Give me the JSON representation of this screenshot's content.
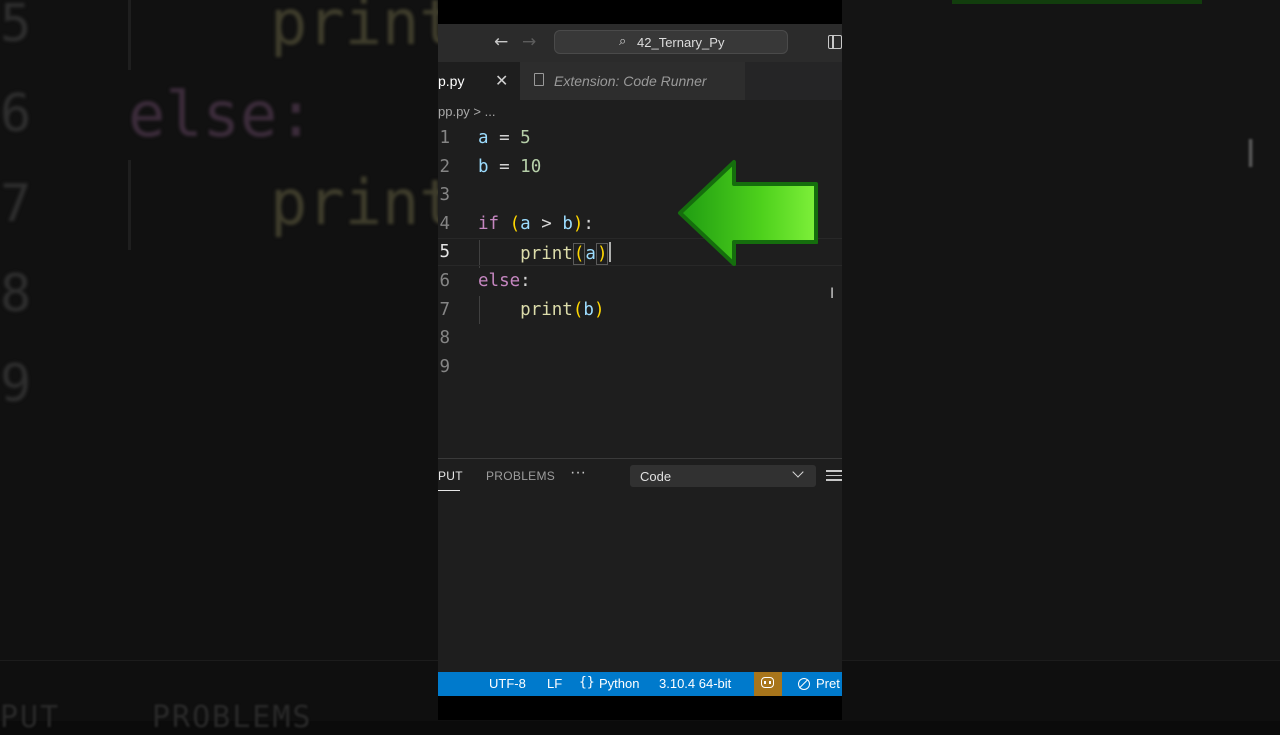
{
  "window": {
    "title": "42_Ternary_Py",
    "nav": {
      "back": "←",
      "forward": "→"
    }
  },
  "tabs": [
    {
      "label": "p.py",
      "active": true,
      "close": "✕"
    },
    {
      "label": "Extension: Code Runner",
      "active": false
    }
  ],
  "breadcrumb": "pp.py > ...",
  "editor": {
    "lines": [
      {
        "num": "1",
        "tokens": [
          {
            "t": "a",
            "c": "v"
          },
          {
            "t": " = ",
            "c": ""
          },
          {
            "t": "5",
            "c": "n"
          }
        ]
      },
      {
        "num": "2",
        "tokens": [
          {
            "t": "b",
            "c": "v"
          },
          {
            "t": " = ",
            "c": ""
          },
          {
            "t": "10",
            "c": "n"
          }
        ]
      },
      {
        "num": "3",
        "tokens": []
      },
      {
        "num": "4",
        "tokens": [
          {
            "t": "if",
            "c": "k"
          },
          {
            "t": " ",
            "c": ""
          },
          {
            "t": "(",
            "c": "p"
          },
          {
            "t": "a",
            "c": "v"
          },
          {
            "t": " > ",
            "c": ""
          },
          {
            "t": "b",
            "c": "v"
          },
          {
            "t": ")",
            "c": "p"
          },
          {
            "t": ":",
            "c": ""
          }
        ]
      },
      {
        "num": "5",
        "active": true,
        "tokens": [
          {
            "t": "    ",
            "c": ""
          },
          {
            "t": "print",
            "c": "f"
          },
          {
            "t": "(",
            "c": "p pb"
          },
          {
            "t": "a",
            "c": "v"
          },
          {
            "t": ")",
            "c": "p pb"
          }
        ]
      },
      {
        "num": "6",
        "tokens": [
          {
            "t": "else",
            "c": "k"
          },
          {
            "t": ":",
            "c": ""
          }
        ]
      },
      {
        "num": "7",
        "tokens": [
          {
            "t": "    ",
            "c": ""
          },
          {
            "t": "print",
            "c": "f"
          },
          {
            "t": "(",
            "c": "p"
          },
          {
            "t": "b",
            "c": "v"
          },
          {
            "t": ")",
            "c": "p"
          }
        ]
      },
      {
        "num": "8",
        "tokens": []
      },
      {
        "num": "9",
        "tokens": []
      }
    ]
  },
  "panel": {
    "tabs": {
      "output": "PUT",
      "problems": "PROBLEMS",
      "more": "···"
    },
    "dropdown": {
      "selected": "Code"
    }
  },
  "statusbar": {
    "encoding": "UTF-8",
    "eol": "LF",
    "language": "Python",
    "interpreter": "3.10.4 64-bit",
    "prettier": "Pret"
  },
  "background": {
    "line_numbers": [
      "5",
      "6",
      "7",
      "8",
      "9"
    ],
    "code_lines": [
      "print",
      "else:",
      "print"
    ],
    "bottom_tabs": [
      "PUT",
      "PROBLEMS"
    ]
  },
  "colors": {
    "statusbar": "#007acc",
    "keyword": "#c586c0",
    "function": "#dcdcaa",
    "number": "#b5cea8",
    "arrow": "#4ed11c"
  },
  "icons": [
    "search-icon",
    "file-icon",
    "close-icon",
    "layout-icon",
    "chevron-down-icon",
    "filter-icon",
    "copilot-icon",
    "prettier-icon",
    "braces-icon",
    "arrow-icon",
    "text-cursor-icon"
  ]
}
